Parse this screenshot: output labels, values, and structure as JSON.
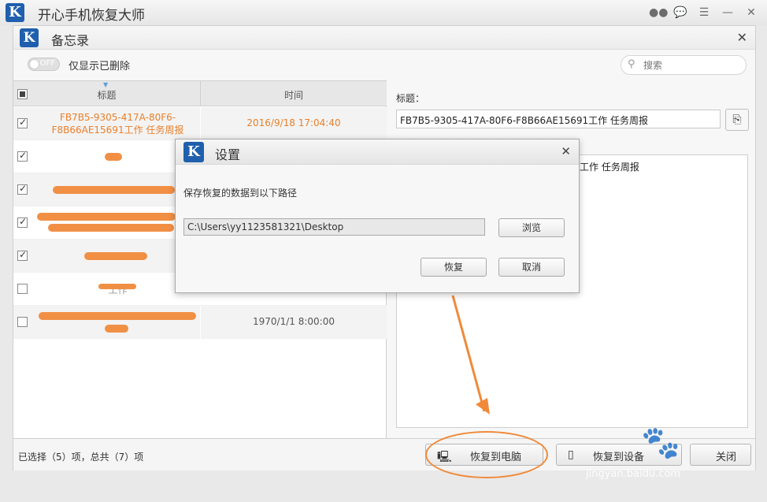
{
  "app": {
    "title": "开心手机恢复大师",
    "logo_letter": "K"
  },
  "memo": {
    "title": "备忘录",
    "logo_letter": "K",
    "toggle": {
      "state": "OFF",
      "label": "仅显示已删除"
    },
    "search_placeholder": "搜索",
    "columns": {
      "title": "标题",
      "time": "时间"
    },
    "rows": [
      {
        "title_line1": "FB7B5-9305-417A-80F6-",
        "title_line2": "F8B66AE15691工作 任务周报",
        "time": "2016/9/18 17:04:40"
      },
      {
        "title_line1": "",
        "title_line2": "",
        "time": ""
      },
      {
        "title_line1": "",
        "title_line2": "",
        "time": ""
      },
      {
        "title_line1": "",
        "title_line2": "",
        "time": ""
      },
      {
        "title_line1": "",
        "title_line2": "",
        "time": ""
      },
      {
        "title_line1": "工作",
        "title_line2": "",
        "time": ""
      },
      {
        "title_line1": "",
        "title_line2": "",
        "time": "1970/1/1 8:00:00"
      }
    ],
    "detail": {
      "title_label": "标题：",
      "title_value": "FB7B5-9305-417A-80F6-F8B66AE15691工作 任务周报",
      "content_partial": "工作 任务周报"
    },
    "footer": {
      "status": "已选择（5）项，总共（7）项",
      "restore_button": "恢复到电脑",
      "device_button": "恢复到设备",
      "close_button": "关闭"
    }
  },
  "dialog": {
    "title": "设置",
    "logo_letter": "K",
    "message": "保存恢复的数据到以下路径",
    "path": "C:\\Users\\yy1123581321\\Desktop",
    "browse": "浏览",
    "restore": "恢复",
    "cancel": "取消"
  },
  "watermark": {
    "url": "jingyan.baidu.com"
  },
  "colors": {
    "accent": "#1f5fae",
    "highlight": "#f08a3a",
    "selected_text": "#e8802d"
  }
}
